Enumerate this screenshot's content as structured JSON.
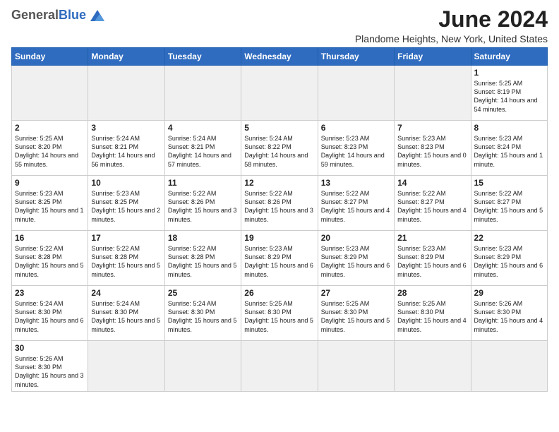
{
  "header": {
    "logo_general": "General",
    "logo_blue": "Blue",
    "month_title": "June 2024",
    "location": "Plandome Heights, New York, United States"
  },
  "days_of_week": [
    "Sunday",
    "Monday",
    "Tuesday",
    "Wednesday",
    "Thursday",
    "Friday",
    "Saturday"
  ],
  "weeks": [
    [
      {
        "day": "",
        "info": ""
      },
      {
        "day": "",
        "info": ""
      },
      {
        "day": "",
        "info": ""
      },
      {
        "day": "",
        "info": ""
      },
      {
        "day": "",
        "info": ""
      },
      {
        "day": "",
        "info": ""
      },
      {
        "day": "1",
        "info": "Sunrise: 5:25 AM\nSunset: 8:19 PM\nDaylight: 14 hours\nand 54 minutes."
      }
    ],
    [
      {
        "day": "2",
        "info": "Sunrise: 5:25 AM\nSunset: 8:20 PM\nDaylight: 14 hours\nand 55 minutes."
      },
      {
        "day": "3",
        "info": "Sunrise: 5:24 AM\nSunset: 8:21 PM\nDaylight: 14 hours\nand 56 minutes."
      },
      {
        "day": "4",
        "info": "Sunrise: 5:24 AM\nSunset: 8:21 PM\nDaylight: 14 hours\nand 57 minutes."
      },
      {
        "day": "5",
        "info": "Sunrise: 5:24 AM\nSunset: 8:22 PM\nDaylight: 14 hours\nand 58 minutes."
      },
      {
        "day": "6",
        "info": "Sunrise: 5:23 AM\nSunset: 8:23 PM\nDaylight: 14 hours\nand 59 minutes."
      },
      {
        "day": "7",
        "info": "Sunrise: 5:23 AM\nSunset: 8:23 PM\nDaylight: 15 hours\nand 0 minutes."
      },
      {
        "day": "8",
        "info": "Sunrise: 5:23 AM\nSunset: 8:24 PM\nDaylight: 15 hours\nand 1 minute."
      }
    ],
    [
      {
        "day": "9",
        "info": "Sunrise: 5:23 AM\nSunset: 8:25 PM\nDaylight: 15 hours\nand 1 minute."
      },
      {
        "day": "10",
        "info": "Sunrise: 5:23 AM\nSunset: 8:25 PM\nDaylight: 15 hours\nand 2 minutes."
      },
      {
        "day": "11",
        "info": "Sunrise: 5:22 AM\nSunset: 8:26 PM\nDaylight: 15 hours\nand 3 minutes."
      },
      {
        "day": "12",
        "info": "Sunrise: 5:22 AM\nSunset: 8:26 PM\nDaylight: 15 hours\nand 3 minutes."
      },
      {
        "day": "13",
        "info": "Sunrise: 5:22 AM\nSunset: 8:27 PM\nDaylight: 15 hours\nand 4 minutes."
      },
      {
        "day": "14",
        "info": "Sunrise: 5:22 AM\nSunset: 8:27 PM\nDaylight: 15 hours\nand 4 minutes."
      },
      {
        "day": "15",
        "info": "Sunrise: 5:22 AM\nSunset: 8:27 PM\nDaylight: 15 hours\nand 5 minutes."
      }
    ],
    [
      {
        "day": "16",
        "info": "Sunrise: 5:22 AM\nSunset: 8:28 PM\nDaylight: 15 hours\nand 5 minutes."
      },
      {
        "day": "17",
        "info": "Sunrise: 5:22 AM\nSunset: 8:28 PM\nDaylight: 15 hours\nand 5 minutes."
      },
      {
        "day": "18",
        "info": "Sunrise: 5:22 AM\nSunset: 8:28 PM\nDaylight: 15 hours\nand 5 minutes."
      },
      {
        "day": "19",
        "info": "Sunrise: 5:23 AM\nSunset: 8:29 PM\nDaylight: 15 hours\nand 6 minutes."
      },
      {
        "day": "20",
        "info": "Sunrise: 5:23 AM\nSunset: 8:29 PM\nDaylight: 15 hours\nand 6 minutes."
      },
      {
        "day": "21",
        "info": "Sunrise: 5:23 AM\nSunset: 8:29 PM\nDaylight: 15 hours\nand 6 minutes."
      },
      {
        "day": "22",
        "info": "Sunrise: 5:23 AM\nSunset: 8:29 PM\nDaylight: 15 hours\nand 6 minutes."
      }
    ],
    [
      {
        "day": "23",
        "info": "Sunrise: 5:24 AM\nSunset: 8:30 PM\nDaylight: 15 hours\nand 6 minutes."
      },
      {
        "day": "24",
        "info": "Sunrise: 5:24 AM\nSunset: 8:30 PM\nDaylight: 15 hours\nand 5 minutes."
      },
      {
        "day": "25",
        "info": "Sunrise: 5:24 AM\nSunset: 8:30 PM\nDaylight: 15 hours\nand 5 minutes."
      },
      {
        "day": "26",
        "info": "Sunrise: 5:25 AM\nSunset: 8:30 PM\nDaylight: 15 hours\nand 5 minutes."
      },
      {
        "day": "27",
        "info": "Sunrise: 5:25 AM\nSunset: 8:30 PM\nDaylight: 15 hours\nand 5 minutes."
      },
      {
        "day": "28",
        "info": "Sunrise: 5:25 AM\nSunset: 8:30 PM\nDaylight: 15 hours\nand 4 minutes."
      },
      {
        "day": "29",
        "info": "Sunrise: 5:26 AM\nSunset: 8:30 PM\nDaylight: 15 hours\nand 4 minutes."
      }
    ],
    [
      {
        "day": "30",
        "info": "Sunrise: 5:26 AM\nSunset: 8:30 PM\nDaylight: 15 hours\nand 3 minutes."
      },
      {
        "day": "",
        "info": ""
      },
      {
        "day": "",
        "info": ""
      },
      {
        "day": "",
        "info": ""
      },
      {
        "day": "",
        "info": ""
      },
      {
        "day": "",
        "info": ""
      },
      {
        "day": "",
        "info": ""
      }
    ]
  ]
}
